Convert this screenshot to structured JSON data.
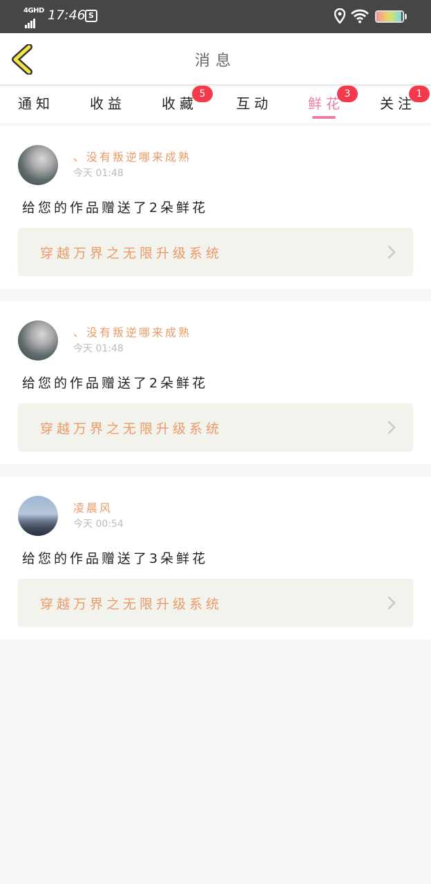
{
  "status_bar": {
    "network": "4GHD",
    "time": "17:46",
    "s_icon": "S",
    "battery_level": 0.95,
    "icons": [
      "signal-icon",
      "screenshot-icon",
      "location-icon",
      "wifi-icon",
      "battery-icon"
    ]
  },
  "header": {
    "title": "消息",
    "back_icon": "chevron-left-icon",
    "back_color": "#f2e44a"
  },
  "tabs": [
    {
      "label": "通知",
      "badge": ""
    },
    {
      "label": "收益",
      "badge": ""
    },
    {
      "label": "收藏",
      "badge": "5"
    },
    {
      "label": "互动",
      "badge": ""
    },
    {
      "label": "鲜花",
      "badge": "3",
      "active": true
    },
    {
      "label": "关注",
      "badge": "1"
    }
  ],
  "messages": [
    {
      "sender": "、没有叛逆哪来成熟",
      "time": "今天 01:48",
      "text": "给您的作品赠送了2朵鲜花",
      "work": "穿越万界之无限升级系统"
    },
    {
      "sender": "、没有叛逆哪来成熟",
      "time": "今天 01:48",
      "text": "给您的作品赠送了2朵鲜花",
      "work": "穿越万界之无限升级系统"
    },
    {
      "sender": "凌晨风",
      "time": "今天 00:54",
      "text": "给您的作品赠送了3朵鲜花",
      "work": "穿越万界之无限升级系统"
    }
  ],
  "colors": {
    "accent_pink": "#f07ba4",
    "sender_orange": "#ea9a66",
    "badge_red": "#f23a4c"
  }
}
